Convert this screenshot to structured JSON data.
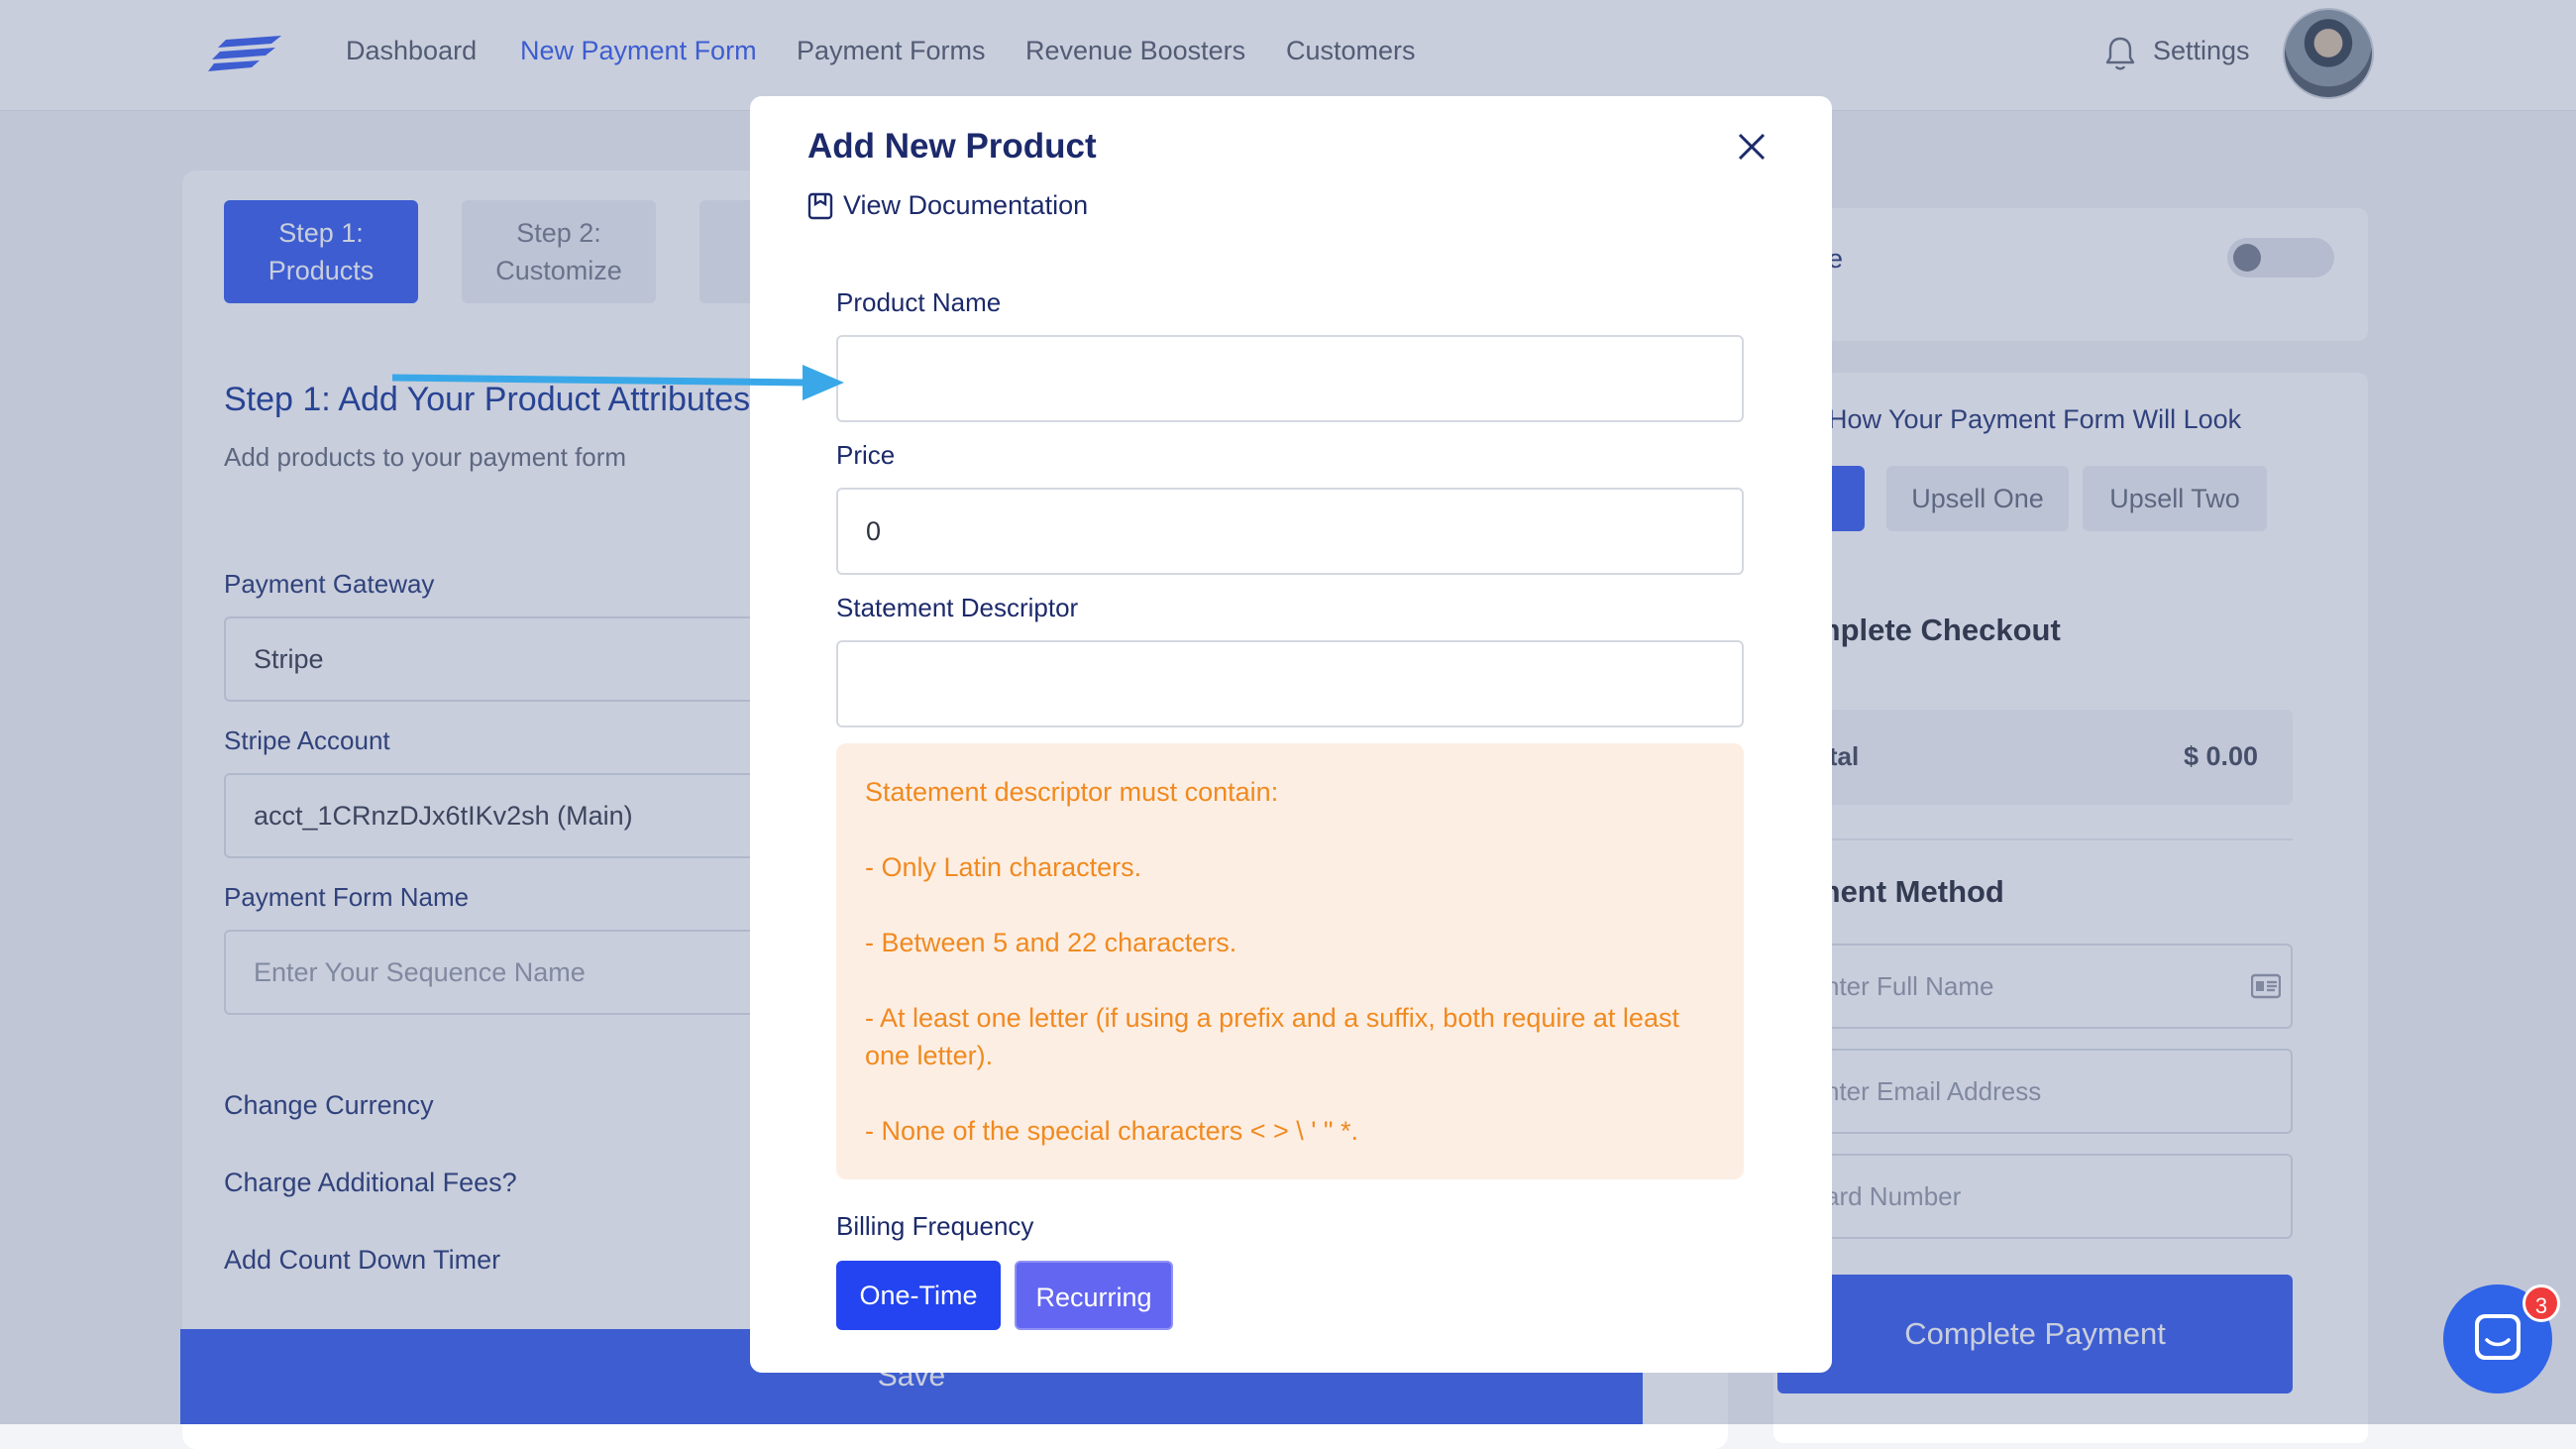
{
  "nav": {
    "items": [
      "Dashboard",
      "New Payment Form",
      "Payment Forms",
      "Revenue Boosters",
      "Customers"
    ],
    "active_index": 1,
    "settings_label": "Settings"
  },
  "steps": [
    {
      "label_line1": "Step 1:",
      "label_line2": "Products"
    },
    {
      "label_line1": "Step 2:",
      "label_line2": "Customize"
    }
  ],
  "section": {
    "title": "Step 1: Add Your Product Attributes",
    "subtitle": "Add products to your payment form"
  },
  "form": {
    "gateway_label": "Payment Gateway",
    "gateway_value": "Stripe",
    "account_label": "Stripe Account",
    "account_value": "acct_1CRnzDJx6tIKv2sh (Main)",
    "form_name_label": "Payment Form Name",
    "form_name_placeholder": "Enter Your Sequence Name",
    "change_currency": "Change Currency",
    "additional_fees": "Charge Additional Fees?",
    "countdown": "Add Count Down Timer",
    "save_label": "Save"
  },
  "preview": {
    "test_mode_label": "de",
    "title": ": How Your Payment Form Will Look",
    "tabs": [
      "Upsell One",
      "Upsell Two"
    ],
    "checkout_heading": "mplete Checkout",
    "total_label": "otal",
    "total_value": "$ 0.00",
    "payment_method_heading": "ment Method",
    "full_name_placeholder": "nter Full Name",
    "email_placeholder": "nter Email Address",
    "card_placeholder": "ard Number",
    "complete_button": "Complete Payment"
  },
  "modal": {
    "title": "Add New Product",
    "doc_link": "View Documentation",
    "product_name_label": "Product Name",
    "product_name_value": "",
    "price_label": "Price",
    "price_value": "0",
    "descriptor_label": "Statement Descriptor",
    "descriptor_value": "",
    "warning_lines": [
      "Statement descriptor must contain:",
      "- Only Latin characters.",
      "- Between 5 and 22 characters.",
      "- At least one letter (if using a prefix and a suffix, both require at least one letter).",
      "- None of the special characters < > \\ ' \" *."
    ],
    "billing_label": "Billing Frequency",
    "billing_options": [
      "One-Time",
      "Recurring"
    ]
  },
  "chat": {
    "badge_count": "3"
  },
  "colors": {
    "accent": "#3d63f0",
    "warning_text": "#f08a20",
    "warning_bg": "#fdeee3",
    "arrow": "#3aa8e8",
    "badge": "#ef3b3b"
  }
}
